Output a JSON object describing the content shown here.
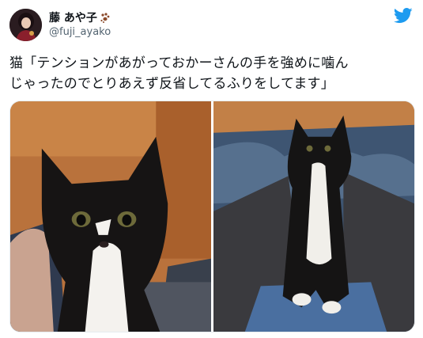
{
  "user": {
    "display_name": "藤 あや子",
    "handle": "@fuji_ayako",
    "name_emoji": "paw-prints-emoji",
    "avatar": "avatar-photo"
  },
  "brand": {
    "logo": "twitter-bird-icon",
    "color": "#1d9bf0"
  },
  "tweet": {
    "line1": "猫「テンションがあがっておかーさんの手を強めに噛ん",
    "line2": "じゃったのでとりあえず反省してるふりをしてます」"
  },
  "media": {
    "photos": [
      {
        "subject": "black-and-white-cat-closeup"
      },
      {
        "subject": "black-and-white-cat-on-lap"
      }
    ]
  }
}
